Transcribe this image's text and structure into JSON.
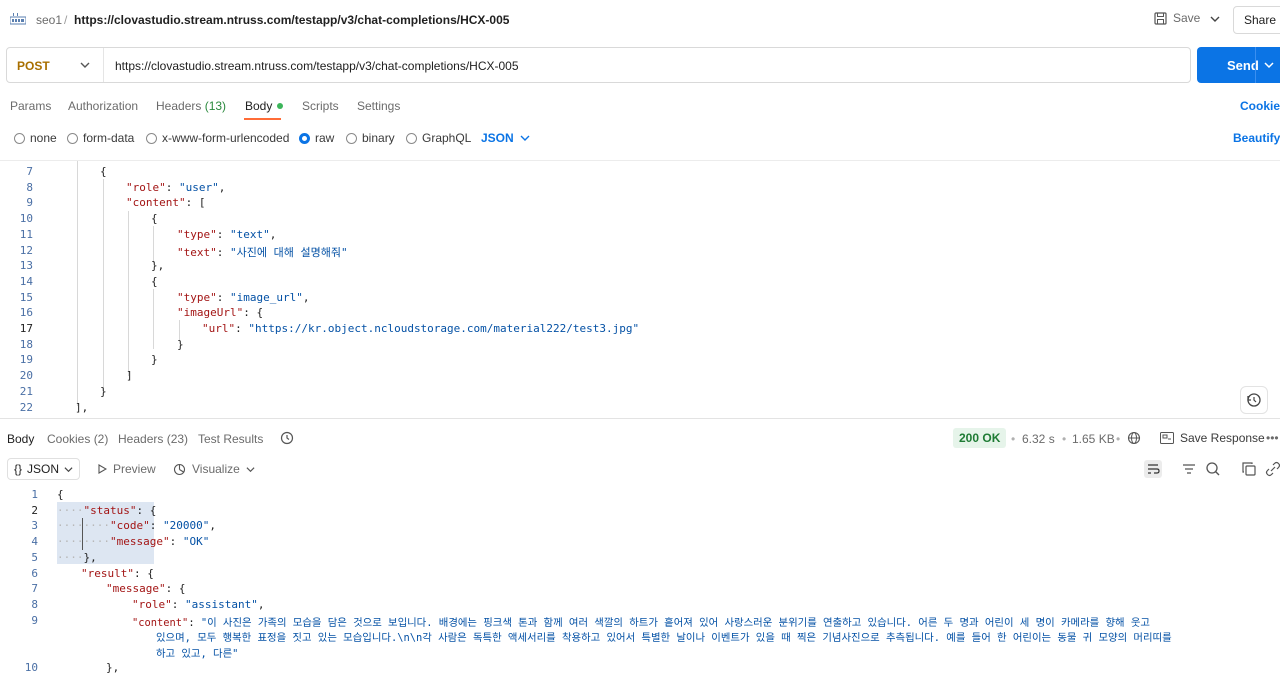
{
  "header": {
    "breadcrumb": "seo1",
    "separator": "/",
    "title": "https://clovastudio.stream.ntruss.com/testapp/v3/chat-completions/HCX-005",
    "save_label": "Save",
    "share_label": "Share"
  },
  "request": {
    "method": "POST",
    "url": "https://clovastudio.stream.ntruss.com/testapp/v3/chat-completions/HCX-005",
    "send_label": "Send",
    "method_color": "#a86f00",
    "send_color": "#0b74e5"
  },
  "req_tabs": {
    "params": "Params",
    "authorization": "Authorization",
    "headers": "Headers",
    "headers_count": "(13)",
    "body": "Body",
    "scripts": "Scripts",
    "settings": "Settings",
    "cookies": "Cookies"
  },
  "body_types": {
    "none": "none",
    "form_data": "form-data",
    "urlencoded": "x-www-form-urlencoded",
    "raw": "raw",
    "binary": "binary",
    "graphql": "GraphQL",
    "language": "JSON",
    "beautify": "Beautify",
    "selected": "raw"
  },
  "request_body": {
    "lines": [
      {
        "n": "7",
        "key": "",
        "text": "{"
      },
      {
        "n": "8",
        "key": "\"role\"",
        "text": ": ",
        "str": "\"user\"",
        "tail": ","
      },
      {
        "n": "9",
        "key": "\"content\"",
        "text": ": [",
        "str": "",
        "tail": ""
      },
      {
        "n": "10",
        "key": "",
        "text": "{"
      },
      {
        "n": "11",
        "key": "\"type\"",
        "text": ": ",
        "str": "\"text\"",
        "tail": ","
      },
      {
        "n": "12",
        "key": "\"text\"",
        "text": ": ",
        "str": "\"사진에 대해 설명해줘\"",
        "tail": ""
      },
      {
        "n": "13",
        "key": "",
        "text": "},"
      },
      {
        "n": "14",
        "key": "",
        "text": "{"
      },
      {
        "n": "15",
        "key": "\"type\"",
        "text": ": ",
        "str": "\"image_url\"",
        "tail": ","
      },
      {
        "n": "16",
        "key": "\"imageUrl\"",
        "text": ": {",
        "str": "",
        "tail": ""
      },
      {
        "n": "17",
        "key": "\"url\"",
        "text": ": ",
        "str": "\"https://kr.object.ncloudstorage.com/material222/test3.jpg\"",
        "tail": ""
      },
      {
        "n": "18",
        "key": "",
        "text": "}"
      },
      {
        "n": "19",
        "key": "",
        "text": "}"
      },
      {
        "n": "20",
        "key": "",
        "text": "]"
      },
      {
        "n": "21",
        "key": "",
        "text": "}"
      },
      {
        "n": "22",
        "key": "",
        "text": "],"
      }
    ]
  },
  "res_tabs": {
    "body": "Body",
    "cookies": "Cookies (2)",
    "headers": "Headers (23)",
    "test_results": "Test Results",
    "status": "200 OK",
    "time": "6.32 s",
    "size": "1.65 KB",
    "save_response": "Save Response",
    "status_color": "#1e7b34"
  },
  "res_view": {
    "format": "JSON",
    "preview": "Preview",
    "visualize": "Visualize"
  },
  "response_body": {
    "lines": [
      {
        "n": "1",
        "text": "{"
      },
      {
        "n": "2",
        "key": "\"status\"",
        "text": ": {"
      },
      {
        "n": "3",
        "key": "\"code\"",
        "text": ": ",
        "str": "\"20000\"",
        "tail": ","
      },
      {
        "n": "4",
        "key": "\"message\"",
        "text": ": ",
        "str": "\"OK\""
      },
      {
        "n": "5",
        "text": "},"
      },
      {
        "n": "6",
        "key": "\"result\"",
        "text": ": {"
      },
      {
        "n": "7",
        "key": "\"message\"",
        "text": ": {"
      },
      {
        "n": "8",
        "key": "\"role\"",
        "text": ": ",
        "str": "\"assistant\"",
        "tail": ","
      },
      {
        "n": "9",
        "key": "\"content\"",
        "text": ": ",
        "str": "\"이 사진은 가족의 모습을 담은 것으로 보입니다. 배경에는 핑크색 톤과 함께 여러 색깔의 하트가 흩어져 있어 사랑스러운 분위기를 연출하고 있습니다. 어른 두 명과 어린이 세 명이 카메라를 향해 웃고"
      },
      {
        "n": "",
        "str": "있으며, 모두 행복한 표정을 짓고 있는 모습입니다.\\n\\n각 사람은 독특한 액세서리를 착용하고 있어서 특별한 날이나 이벤트가 있을 때 찍은 기념사진으로 추측됩니다. 예를 들어 한 어린이는 동물 귀 모양의 머리띠를"
      },
      {
        "n": "",
        "str": "하고 있고, 다른\""
      },
      {
        "n": "10",
        "text": "},"
      }
    ]
  }
}
